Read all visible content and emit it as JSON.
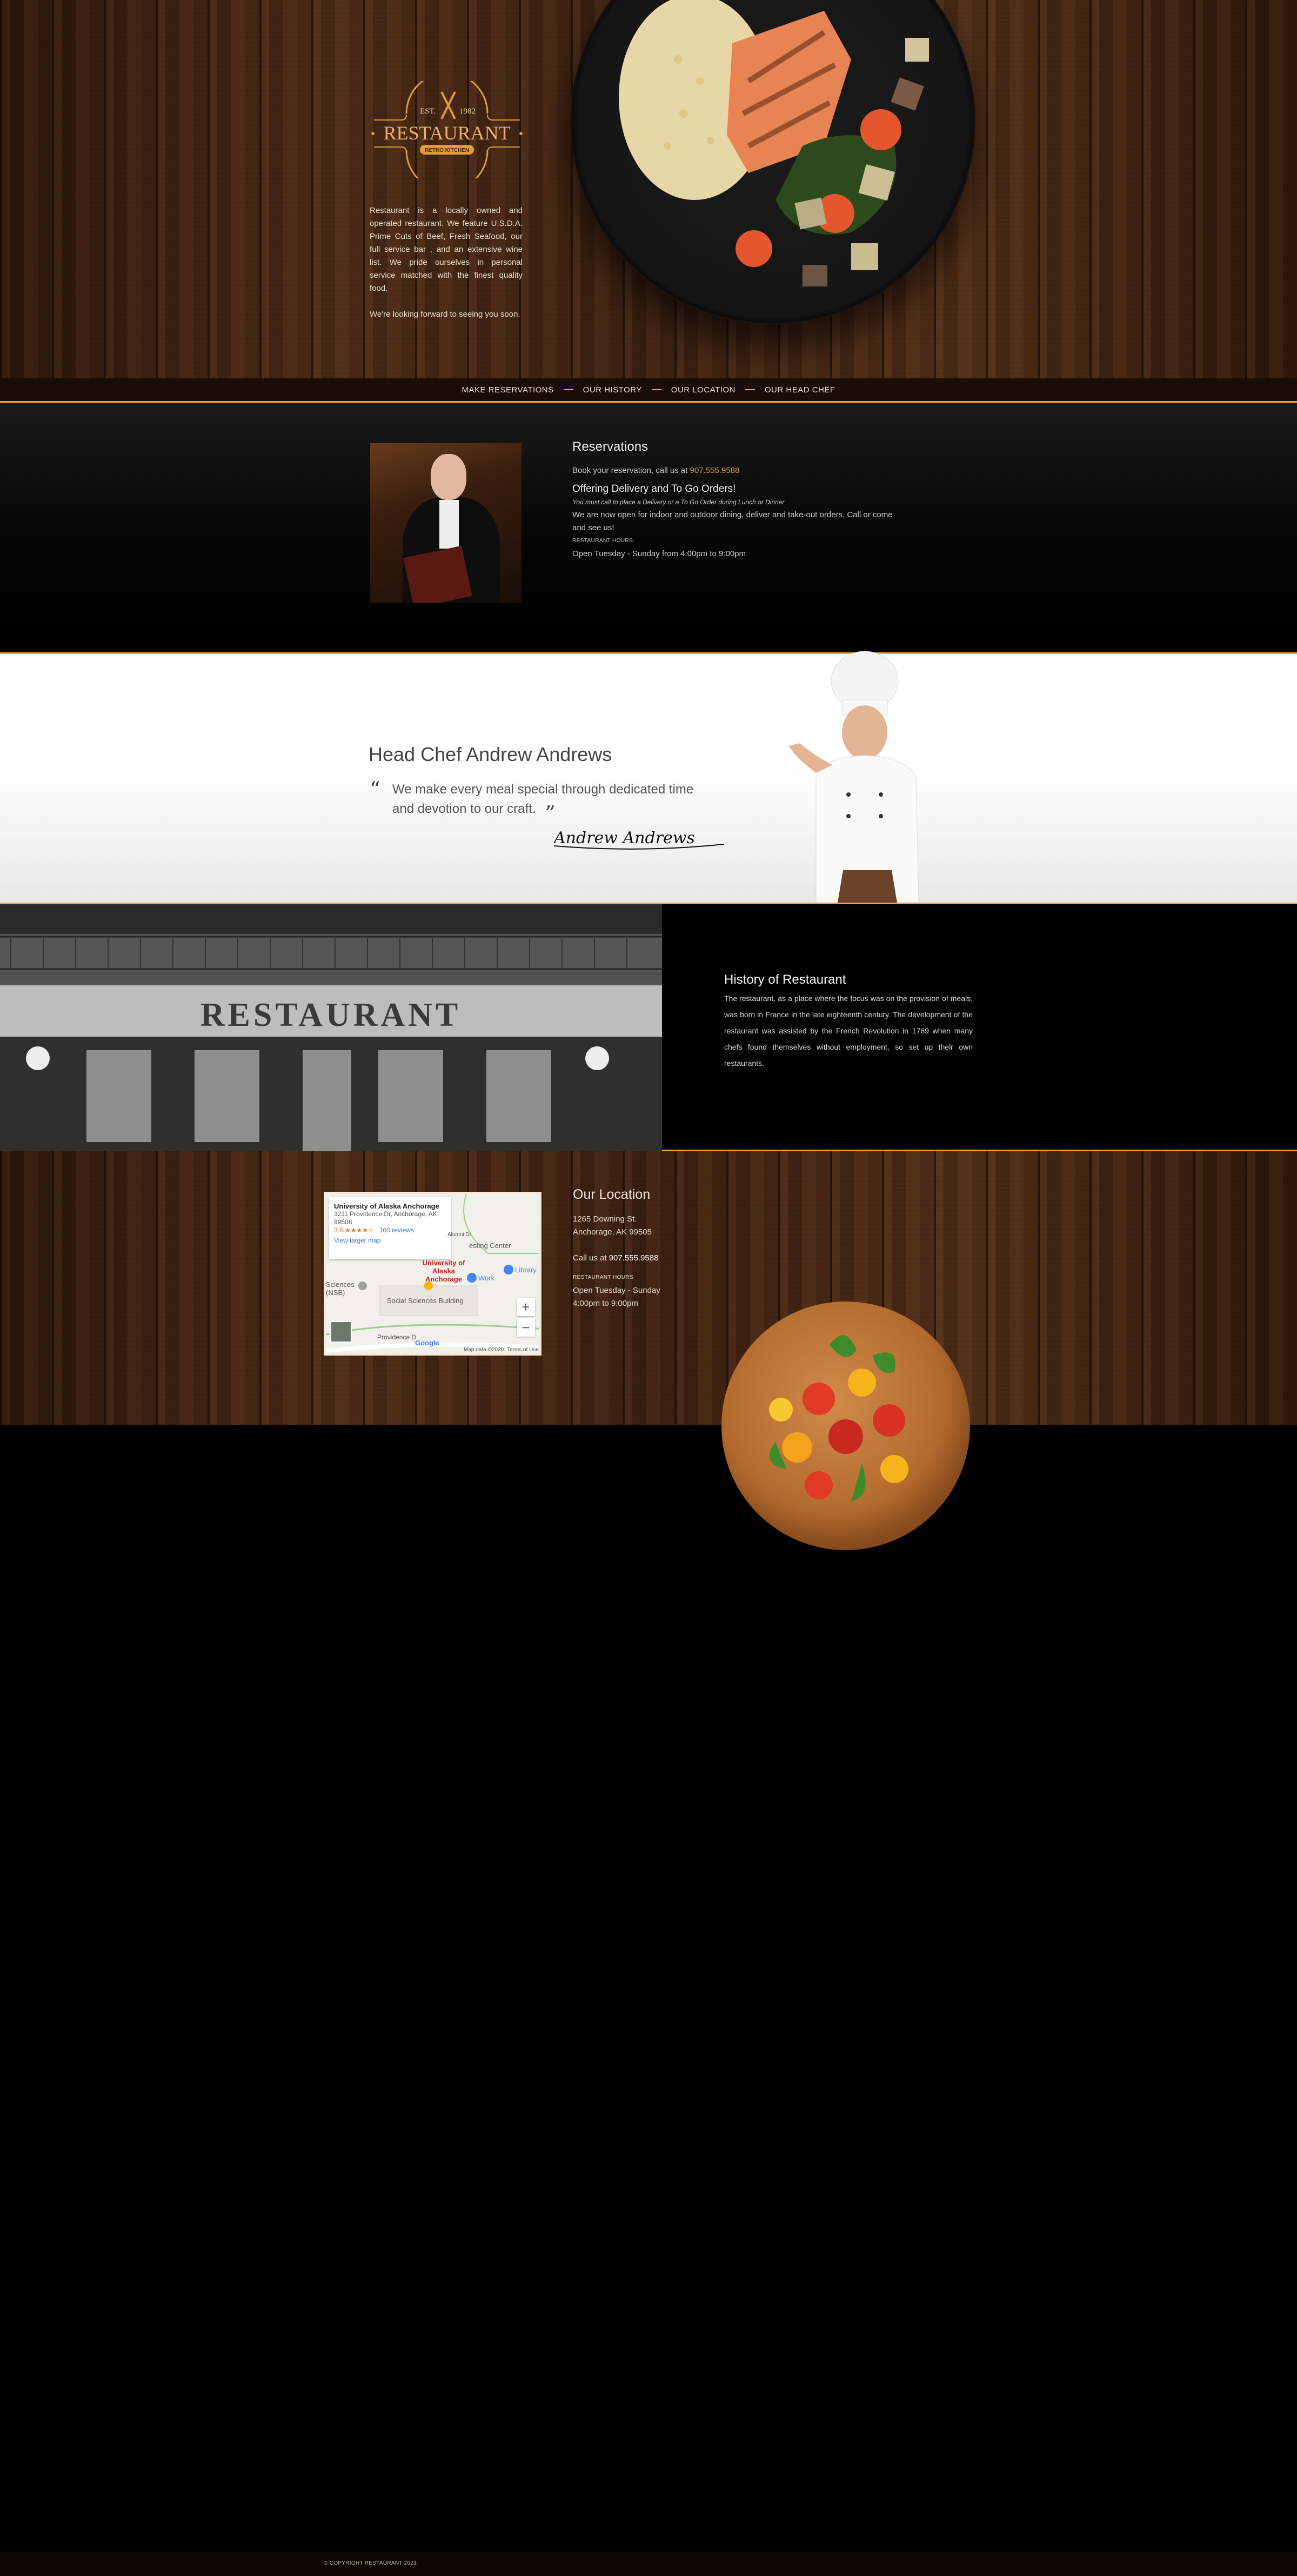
{
  "logo": {
    "est": "EST.",
    "year": "1982",
    "name": "RESTAURANT",
    "tagline": "RETRO KITCHEN"
  },
  "hero": {
    "intro": "Restaurant is a locally owned and operated restaurant. We feature U.S.D.A. Prime Cuts of Beef, Fresh Seafood, our full service bar , and an extensive wine list. We pride ourselves in personal service matched with the finest quality food.",
    "closing": "We're looking forward to seeing you soon."
  },
  "nav": {
    "items": [
      {
        "label": "MAKE RESERVATIONS"
      },
      {
        "label": "OUR HISTORY"
      },
      {
        "label": "OUR LOCATION"
      },
      {
        "label": "OUR HEAD CHEF"
      }
    ]
  },
  "reservations": {
    "title": "Reservations",
    "book_text": "Book your reservation, call us at",
    "phone": "907.555.9588",
    "delivery_title": "Offering Delivery and To Go Orders!",
    "delivery_note": "You must call to place a Delivery or a To Go Order during Lunch or Dinner",
    "open_text": "We are now open for indoor and outdoor dining, deliver and take-out orders. Call or come and see us!",
    "hours_label": "RESTAURANT HOURS:",
    "hours": "Open Tuesday - Sunday from 4:00pm to 9:00pm"
  },
  "chef": {
    "title": "Head Chef Andrew Andrews",
    "quote": "We make every meal special through dedicated time and devotion to our craft.",
    "signature": "Andrew Andrews",
    "open_quote": "“",
    "close_quote": "”"
  },
  "history": {
    "sign": "RESTAURANT",
    "title": "History of Restaurant",
    "text": "The restaurant, as a place where the focus was on the provision of meals, was born in France in the late eighteenth century. The development of the restaurant was assisted by the French Revolution in 1789 when many chefs found themselves without employment, so set up their own restaurants."
  },
  "map": {
    "place": "University of Alaska Anchorage",
    "address": "3211 Providence Dr, Anchorage, AK 99508",
    "rating": "3.6",
    "stars": "★★★★☆",
    "reviews": "100 reviews",
    "larger": "View larger map",
    "pin_label": "University of Alaska Anchorage",
    "building": "Social Sciences Building",
    "testing": "esting Center",
    "work": "Work",
    "library": "Library",
    "sciences": "Sciences (NSB)",
    "alumni": "Alumni Dr",
    "road": "Providence D",
    "google": "Google",
    "data": "Map data ©2020",
    "terms": "Terms of Use",
    "zoom_in": "+",
    "zoom_out": "−"
  },
  "location": {
    "title": "Our Location",
    "street": "1265 Downing St.",
    "city": "Anchorage, AK 99505",
    "call_text": "Call us at",
    "phone": "907.555.9588",
    "hours_label": "RESTAURANT HOURS",
    "hours_days": "Open Tuesday - Sunday",
    "hours_time": "4:00pm to 9:00pm"
  },
  "footer": {
    "copyright": "© COPYRIGHT RESTAURANT 2021"
  },
  "colors": {
    "accent": "#f3a33a",
    "phone": "#c99a52"
  }
}
